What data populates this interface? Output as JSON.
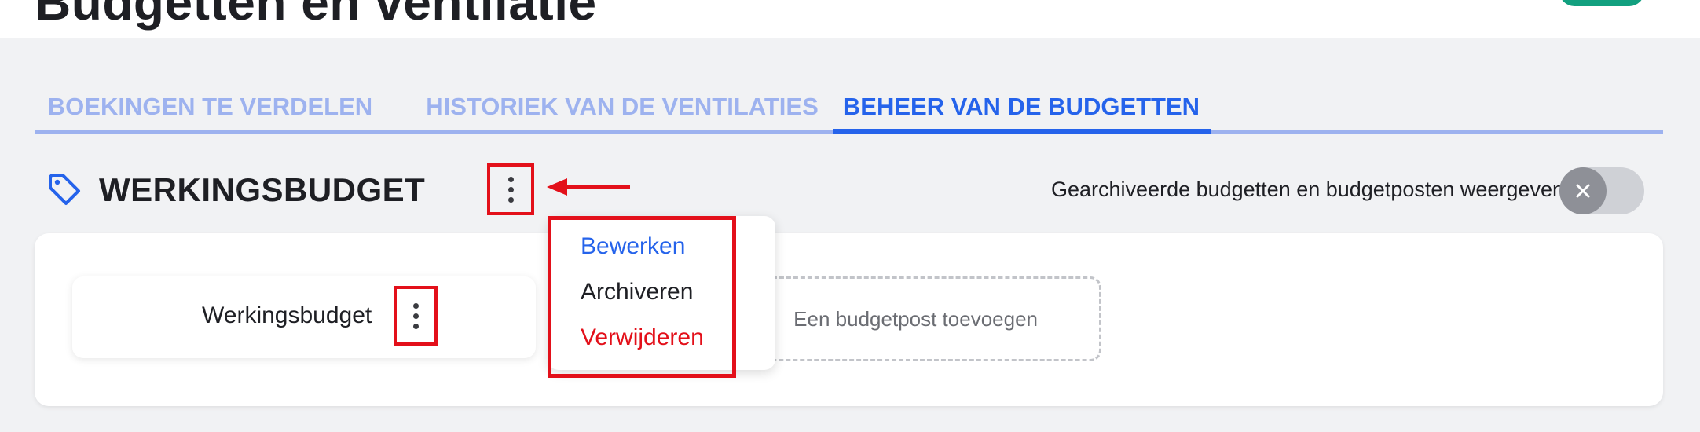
{
  "header": {
    "title": "Budgetten en ventilatie"
  },
  "tabs": [
    {
      "label": "BOEKINGEN TE VERDELEN",
      "active": false
    },
    {
      "label": "HISTORIEK VAN DE VENTILATIES",
      "active": false
    },
    {
      "label": "BEHEER VAN DE BUDGETTEN",
      "active": true
    }
  ],
  "section": {
    "title": "WERKINGSBUDGET"
  },
  "archive_toggle": {
    "label": "Gearchiveerde budgetten en budgetposten weergeven",
    "enabled": false
  },
  "budgets": [
    {
      "name": "Werkingsbudget"
    }
  ],
  "add_post": {
    "label": "Een budgetpost toevoegen"
  },
  "dropdown": {
    "items": [
      {
        "label": "Bewerken"
      },
      {
        "label": "Archiveren"
      },
      {
        "label": "Verwijderen"
      }
    ]
  },
  "colors": {
    "accent": "#2563eb",
    "tab_inactive": "#9db2ef",
    "danger": "#e3101a",
    "highlight": "#e3101a",
    "primary_action": "#12a07f"
  },
  "icons": {
    "section": "tag-icon",
    "menu": "vertical-dots-icon",
    "toggle": "close-icon",
    "annotation": "arrow-left-icon"
  }
}
